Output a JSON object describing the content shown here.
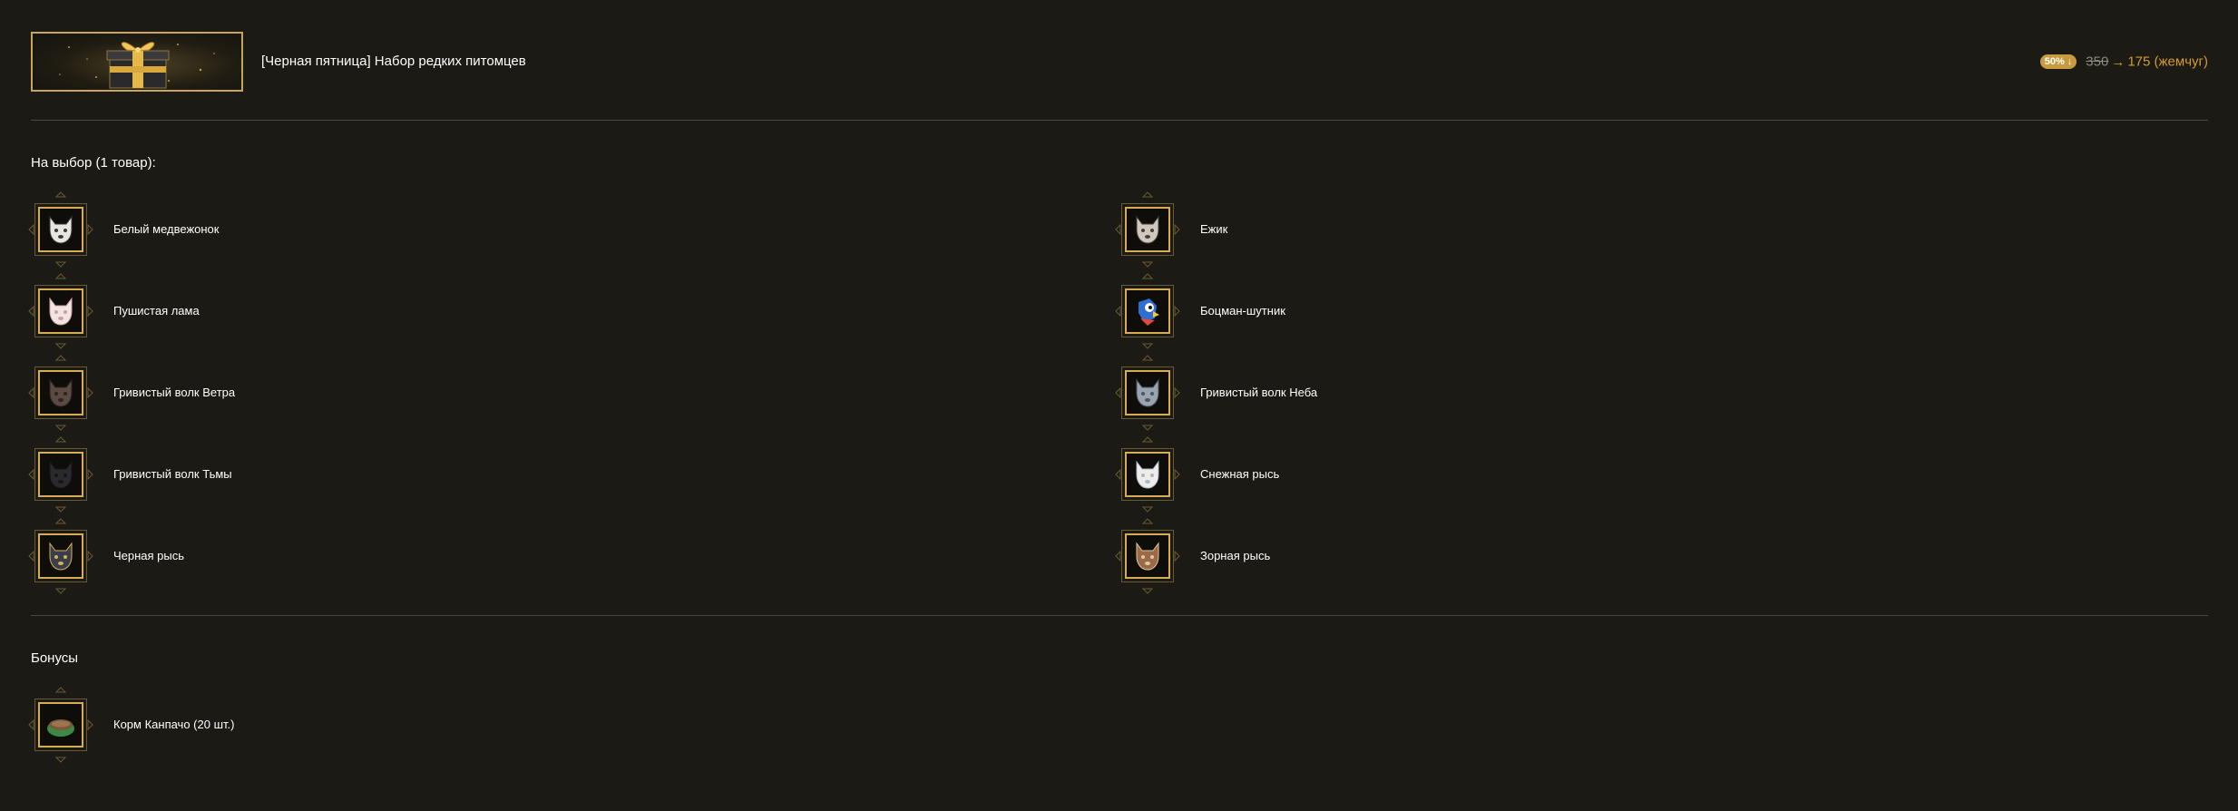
{
  "header": {
    "title": "[Черная пятница] Набор редких питомцев",
    "discount_badge": "50% ↓",
    "old_price": "350",
    "arrow": "→",
    "new_price": "175 (жемчуг)"
  },
  "choice_section": {
    "label": "На выбор (1 товар):",
    "items": [
      {
        "label": "Белый медвежонок",
        "icon": "white-bear-cub-icon"
      },
      {
        "label": "Ежик",
        "icon": "hedgehog-icon"
      },
      {
        "label": "Пушистая лама",
        "icon": "fluffy-llama-icon"
      },
      {
        "label": "Боцман-шутник",
        "icon": "parrot-icon"
      },
      {
        "label": "Гривистый волк Ветра",
        "icon": "wind-wolf-icon"
      },
      {
        "label": "Гривистый волк Неба",
        "icon": "sky-wolf-icon"
      },
      {
        "label": "Гривистый волк Тьмы",
        "icon": "dark-wolf-icon"
      },
      {
        "label": "Снежная рысь",
        "icon": "snow-lynx-icon"
      },
      {
        "label": "Черная рысь",
        "icon": "black-lynx-icon"
      },
      {
        "label": "Зорная рысь",
        "icon": "dawn-lynx-icon"
      }
    ]
  },
  "bonus_section": {
    "label": "Бонусы",
    "items": [
      {
        "label": "Корм Канпачо (20 шт.)",
        "icon": "pet-food-bowl-icon"
      }
    ]
  },
  "colors": {
    "background": "#1b1a14",
    "accent_gold": "#d8ab55",
    "price_orange": "#d69b2e",
    "badge": "#c99a3e",
    "divider": "#4c4a3e"
  }
}
